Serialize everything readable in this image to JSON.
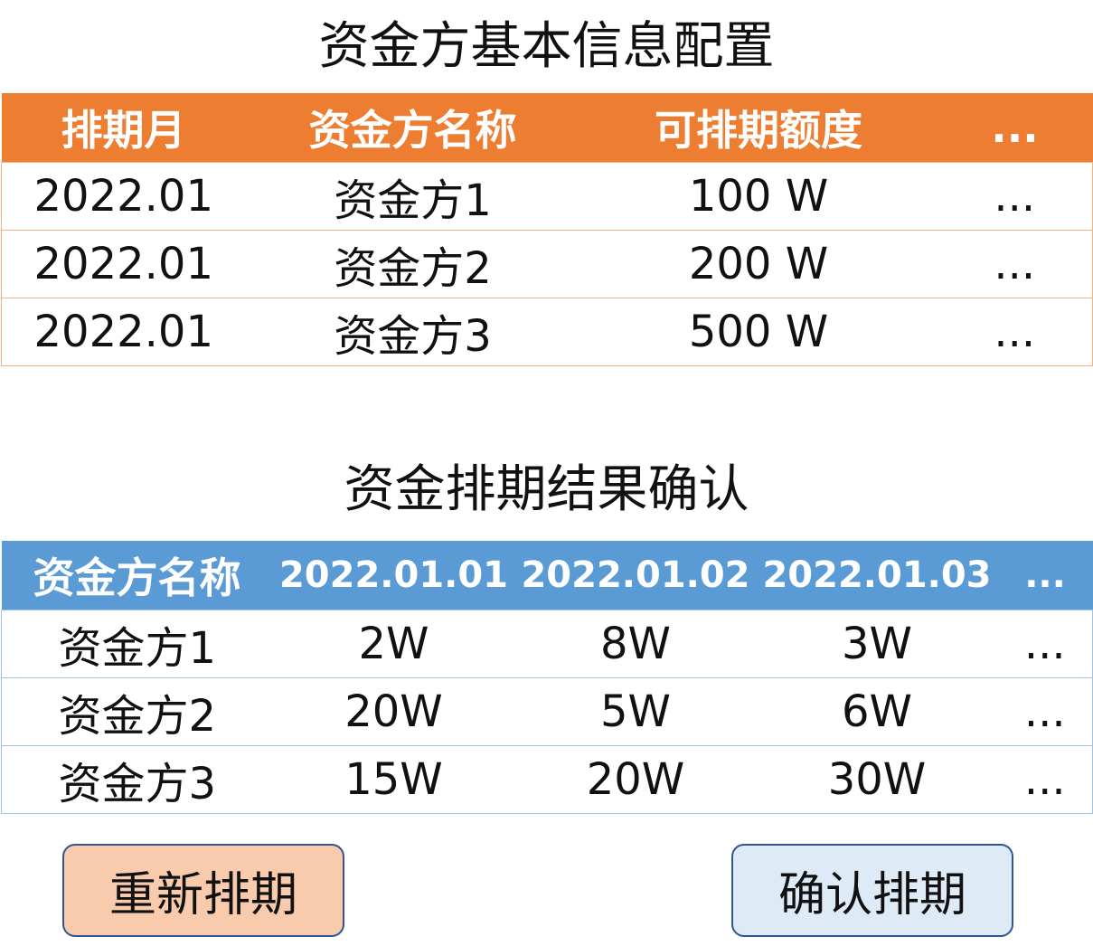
{
  "section1": {
    "title": "资金方基本信息配置",
    "headers": [
      "排期月",
      "资金方名称",
      "可排期额度",
      "..."
    ],
    "rows": [
      [
        "2022.01",
        "资金方1",
        "100 W",
        "..."
      ],
      [
        "2022.01",
        "资金方2",
        "200 W",
        "..."
      ],
      [
        "2022.01",
        "资金方3",
        "500 W",
        "..."
      ]
    ]
  },
  "section2": {
    "title": "资金排期结果确认",
    "headers": [
      "资金方名称",
      "2022.01.01",
      "2022.01.02",
      "2022.01.03",
      "..."
    ],
    "rows": [
      [
        "资金方1",
        "2W",
        "8W",
        "3W",
        "..."
      ],
      [
        "资金方2",
        "20W",
        "5W",
        "6W",
        "..."
      ],
      [
        "资金方3",
        "15W",
        "20W",
        "30W",
        "..."
      ]
    ]
  },
  "buttons": {
    "reschedule": "重新排期",
    "confirm": "确认排期"
  },
  "colors": {
    "table1_header": "#ed7d31",
    "table1_border": "#f4b183",
    "table2_header": "#5b9bd5",
    "table2_border": "#9dc3e6",
    "reschedule_button": "#f8cbad",
    "confirm_button": "#deebf7",
    "button_border": "#2f5597"
  }
}
